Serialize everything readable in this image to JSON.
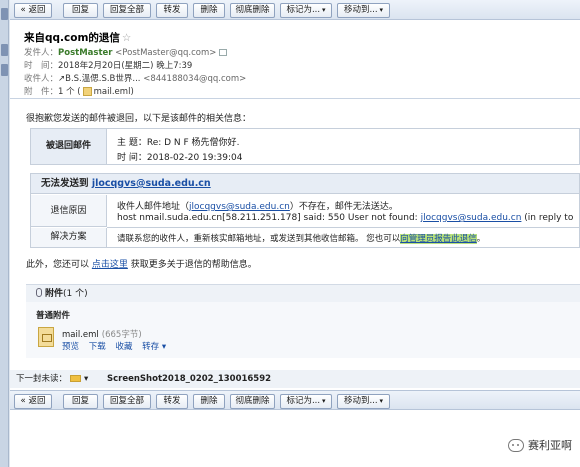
{
  "toolbar": {
    "back": "« 返回",
    "reply": "回复",
    "reply_all": "回复全部",
    "forward": "转发",
    "delete": "删除",
    "delete_forever": "彻底删除",
    "mark_as": "标记为...",
    "move_to": "移动到..."
  },
  "header": {
    "subject": "来自qq.com的退信",
    "star": "☆",
    "from_label": "发件人：",
    "from_name": "PostMaster",
    "from_email": "<PostMaster@qq.com>",
    "time_label": "时　间：",
    "time_value": "2018年2月20日(星期二) 晚上7:39",
    "to_label": "收件人：",
    "to_name": "↗B.S.溫偲.S.B世界...",
    "to_email": "<844188034@qq.com>",
    "attach_label": "附　件：",
    "attach_count": "1 个 (",
    "attach_name": "mail.eml",
    "attach_close": ")"
  },
  "bounce": {
    "intro": "很抱歉您发送的邮件被退回，以下是该邮件的相关信息：",
    "returned_label": "被退回邮件",
    "subject_line": "主  题：Re: D N F 杨先僧你好.",
    "time_line": "时  间：2018-02-20 19:39:04",
    "cannot_label": "无法发送到",
    "cannot_email": "jlocqgvs@suda.edu.cn",
    "reason_label": "退信原因",
    "reason_prefix": "收件人邮件地址（",
    "reason_email": "jlocqgvs@suda.edu.cn",
    "reason_suffix": "）不存在，邮件无法送达。",
    "host_prefix": "host nmail.suda.edu.cn[58.211.251.178] said: 550 User not found: ",
    "host_email": "jlocqgvs@suda.edu.cn",
    "host_suffix": " (in reply to",
    "solution_label": "解决方案",
    "solution_text": "请联系您的收件人，重新核实邮箱地址，或发送到其他收信邮箱。 您也可以",
    "solution_link": "向管理员报告此退信",
    "solution_end": "。",
    "help_prefix": "此外，您还可以 ",
    "help_link": "点击这里",
    "help_suffix": " 获取更多关于退信的帮助信息。"
  },
  "attachments": {
    "title": "附件",
    "count": "(1 个)",
    "category": "普通附件",
    "file_name": "mail.eml",
    "file_size": "(665字节)",
    "actions": [
      "预览",
      "下载",
      "收藏",
      "转存 ▾"
    ]
  },
  "next_mail": {
    "label": "下一封未读：",
    "subject": "ScreenShot2018_0202_130016592"
  },
  "watermark": "赛利亚啊"
}
